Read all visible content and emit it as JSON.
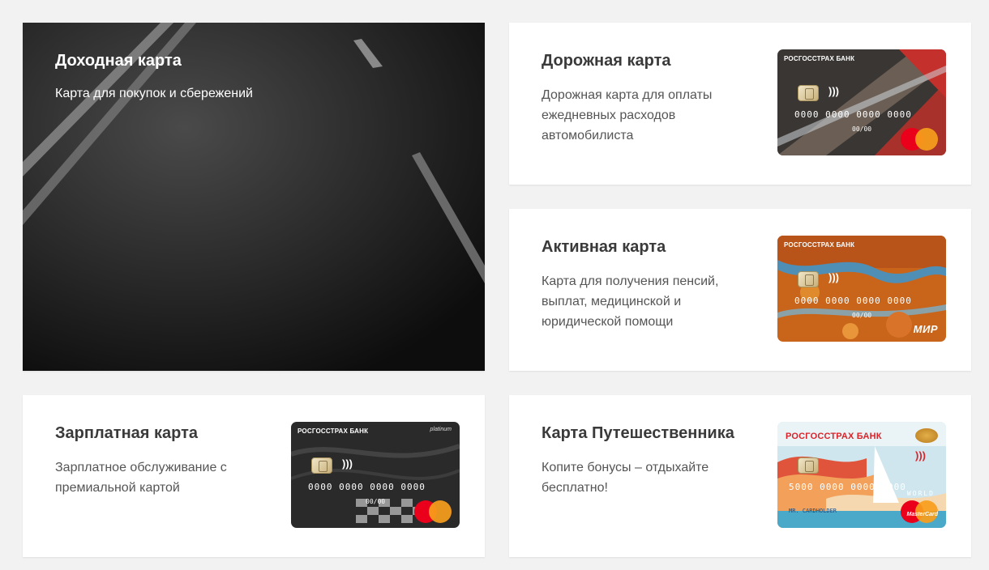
{
  "tiles": {
    "income": {
      "title": "Доходная карта",
      "desc": "Карта для покупок и сбережений"
    },
    "road": {
      "title": "Дорожная карта",
      "desc": "Дорожная карта для оплаты ежедневных расходов автомобилиста",
      "card": {
        "brand": "РОСГОССТРАХ БАНК",
        "number": "0000 0000 0000 0000",
        "expiry": "00/00",
        "payment_system": "mastercard",
        "colors": {
          "accent": "#c4302b"
        }
      }
    },
    "active": {
      "title": "Активная карта",
      "desc": "Карта для получения пенсий, выплат, медицинской и юридической помощи",
      "card": {
        "brand": "РОСГОССТРАХ БАНК",
        "number": "0000 0000 0000 0000",
        "expiry": "00/00",
        "payment_system": "МИР",
        "colors": {
          "accent": "#e07a1e"
        }
      }
    },
    "salary": {
      "title": "Зарплатная карта",
      "desc": "Зарплатное обслуживание с премиальной картой",
      "card": {
        "brand": "РОСГОССТРАХ БАНК",
        "tier": "platinum",
        "number": "0000 0000 0000 0000",
        "expiry": "00/00",
        "payment_system": "mastercard"
      }
    },
    "travel": {
      "title": "Карта Путешественника",
      "desc": "Копите бонусы – отдыхайте бесплатно!",
      "card": {
        "brand": "РОСГОССТРАХ БАНК",
        "number": "5000 0000 0000 0000",
        "world": "WORLD",
        "holder": "MR. CARDHOLDER",
        "payment_system": "MasterCard",
        "colors": {
          "accent": "#d8232a"
        }
      }
    }
  }
}
